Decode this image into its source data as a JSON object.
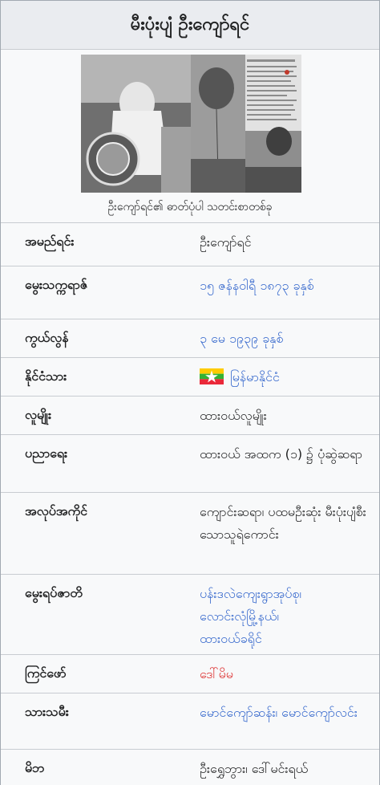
{
  "infobox": {
    "title": "မီးပုံးပျံ ဦးကျော်ရင်",
    "caption": "ဦးကျော်ရင်၏ ဓာတ်ပုံပါ သတင်းစာတစ်ခု",
    "rows": [
      {
        "label": "အမည်ရင်း",
        "value": "ဦးကျော်ရင်"
      },
      {
        "label": "မွေးသက္ကရာဇ်",
        "value": "၁၅ ဇန်နဝါရီ ၁၈၇၃ ခုနှစ်"
      },
      {
        "label": "ကွယ်လွန်",
        "value": "၃ မေ ၁၉၃၉ ခုနှစ်"
      },
      {
        "label": "နိုင်ငံသား",
        "value": "မြန်မာနိုင်ငံ",
        "flag": "myanmar-flag"
      },
      {
        "label": "လူမျိုး",
        "value": "ထားဝယ်လူမျိုး"
      },
      {
        "label": "ပညာရေး",
        "value": "ထားဝယ် အထက (၁) ၌ ပုံဆွဲဆရာ"
      },
      {
        "label": "အလုပ်အကိုင်",
        "value": "ကျောင်းဆရာ၊ ပထမဦးဆုံး မီးပုံးပျံစီးသောသူရဲကောင်း"
      },
      {
        "label": "မွေးရပ်ဇာတိ",
        "parts": [
          "ပန်းဒလဲကျေးရွာအုပ်စု၊",
          "လောင်းလုံမြို့နယ်၊",
          "ထားဝယ်ခရိုင်"
        ]
      },
      {
        "label": "ကြင်ဖော်",
        "value": "ဒေါ်မိမ"
      },
      {
        "label": "သားသမီး",
        "parts": [
          "မောင်ကျော်ဆန်း၊",
          "မောင်ကျော်လင်း"
        ]
      },
      {
        "label": "မိဘ",
        "value": "ဦးရွှေဘွား၊ ဒေါ်မင်းရယ်"
      }
    ]
  },
  "colors": {
    "link": "#3366cc",
    "redlink": "#d33333",
    "border": "#a2a9b1",
    "background": "#f8f9fa"
  }
}
